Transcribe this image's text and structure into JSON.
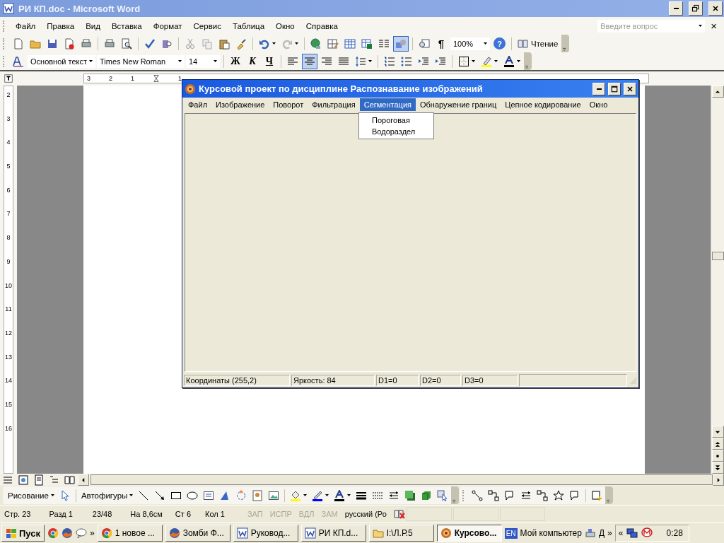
{
  "window": {
    "title": "РИ КП.doc - Microsoft Word"
  },
  "menu": [
    "Файл",
    "Правка",
    "Вид",
    "Вставка",
    "Формат",
    "Сервис",
    "Таблица",
    "Окно",
    "Справка"
  ],
  "help_search": {
    "placeholder": "Введите вопрос",
    "close": "×"
  },
  "standard_toolbar": {
    "pilcrow": "¶",
    "zoom": "100%",
    "help": "?",
    "reading": "Чтение",
    "drawing_pressed": true
  },
  "formatting_toolbar": {
    "style": "Основной текст",
    "font": "Times New Roman",
    "size": "14",
    "bold": "Ж",
    "italic": "К",
    "underline": "Ч",
    "alignment": [
      {
        "kind": "left",
        "selected": false
      },
      {
        "kind": "center",
        "selected": true
      },
      {
        "kind": "right",
        "selected": false
      },
      {
        "kind": "justify",
        "selected": false
      }
    ]
  },
  "ruler": {
    "horizontal": [
      "3",
      "2",
      "1",
      "1"
    ],
    "vertical": [
      "2",
      "3",
      "4",
      "5",
      "6",
      "7",
      "8",
      "9",
      "10",
      "11",
      "12",
      "13",
      "14",
      "15",
      "16"
    ]
  },
  "app_window": {
    "title": "Курсовой проект по дисциплине Распознавание изображений",
    "menu": [
      {
        "label": "Файл",
        "selected": false
      },
      {
        "label": "Изображение",
        "selected": false
      },
      {
        "label": "Поворот",
        "selected": false
      },
      {
        "label": "Фильтрация",
        "selected": false
      },
      {
        "label": "Сегментация",
        "selected": true
      },
      {
        "label": "Обнаружение границ",
        "selected": false
      },
      {
        "label": "Цепное кодирование",
        "selected": false
      },
      {
        "label": "Окно",
        "selected": false
      }
    ],
    "dropdown": [
      "Пороговая",
      "Водораздел"
    ],
    "status": [
      "Координаты (255,2)",
      "Яркость: 84",
      "D1=0",
      "D2=0",
      "D3=0"
    ]
  },
  "drawing_toolbar": {
    "draw_menu": "Рисование",
    "autoshapes": "Автофигуры"
  },
  "status_bar": [
    {
      "text": "Стр. 23",
      "disabled": false
    },
    {
      "text": "Разд 1",
      "disabled": false
    },
    {
      "text": "23/48",
      "disabled": false
    },
    {
      "text": "На 8,6см",
      "disabled": false
    },
    {
      "text": "Ст 6",
      "disabled": false
    },
    {
      "text": "Кол 1",
      "disabled": false
    },
    {
      "text": "ЗАП",
      "disabled": true
    },
    {
      "text": "ИСПР",
      "disabled": true
    },
    {
      "text": "ВДЛ",
      "disabled": true
    },
    {
      "text": "ЗАМ",
      "disabled": true
    },
    {
      "text": "русский (Ро",
      "disabled": false
    }
  ],
  "taskbar": {
    "start": "Пуск",
    "quick_more": "»",
    "tasks": [
      {
        "label": "1 новое ...",
        "kind": "browser",
        "selected": false
      },
      {
        "label": "Зомби Ф...",
        "kind": "fox",
        "selected": false
      },
      {
        "label": "Руковод...",
        "kind": "word",
        "selected": false
      },
      {
        "label": "РИ КП.d...",
        "kind": "word",
        "selected": false
      },
      {
        "label": "I:\\Л.Р.5",
        "kind": "folder",
        "selected": false
      },
      {
        "label": "Курсово...",
        "kind": "app",
        "selected": true
      }
    ],
    "language": "EN",
    "toolbar_label": "Мой компьютер",
    "drive": "Д",
    "toolbar_more": "»",
    "tray_toggle": "«",
    "clock": "0:28"
  }
}
